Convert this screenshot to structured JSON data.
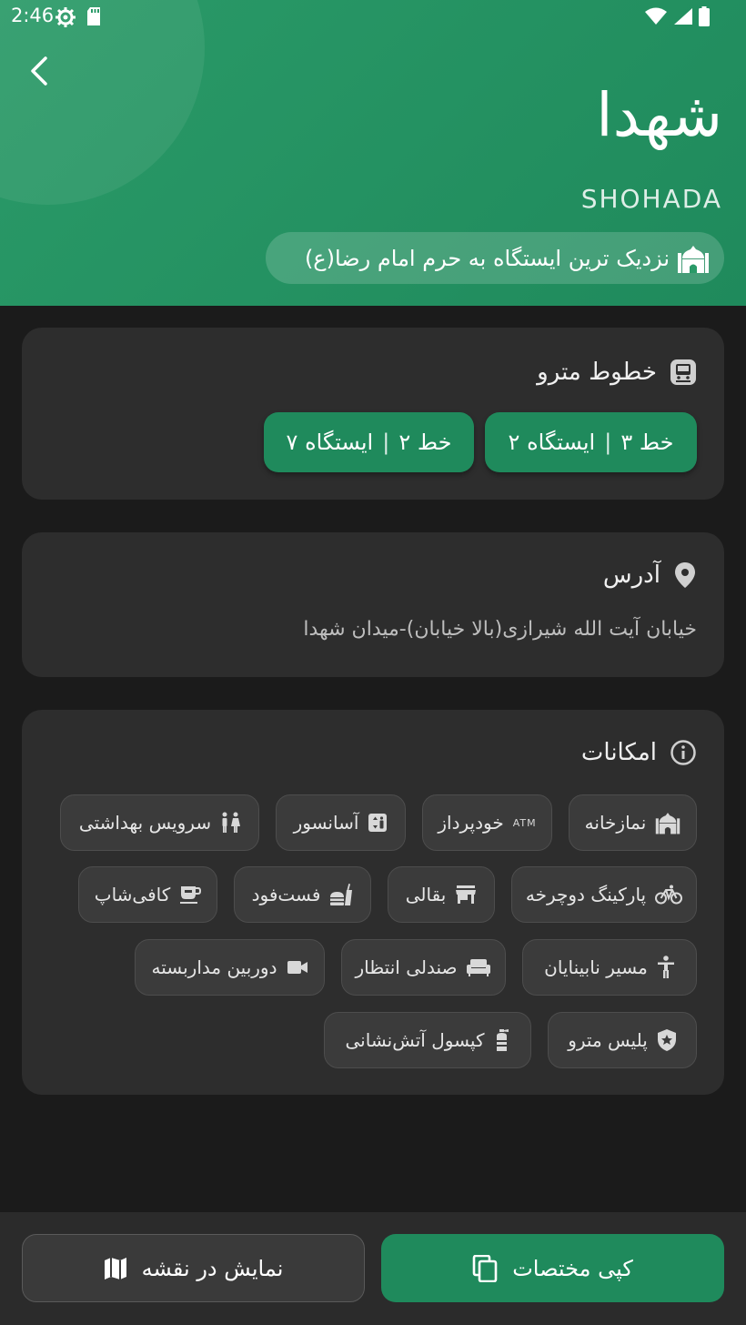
{
  "status_bar": {
    "time": "2:46"
  },
  "header": {
    "title": "شهدا",
    "latin_title": "SHOHADA",
    "nearest_note": "نزدیک ترین ایستگاه به حرم امام رضا(ع)"
  },
  "metro_lines": {
    "title": "خطوط مترو",
    "chips": [
      {
        "line": "خط ۳",
        "station": "ایستگاه ۲"
      },
      {
        "line": "خط ۲",
        "station": "ایستگاه ۷"
      }
    ]
  },
  "address": {
    "title": "آدرس",
    "text": "خیابان آیت الله شیرازی(بالا خیابان)-میدان شهدا"
  },
  "facilities": {
    "title": "امکانات",
    "items": [
      {
        "label": "نمازخانه",
        "icon": "mosque-icon"
      },
      {
        "label": "خودپرداز",
        "icon": "atm-icon",
        "icon_text": "ATM"
      },
      {
        "label": "آسانسور",
        "icon": "elevator-icon"
      },
      {
        "label": "سرویس بهداشتی",
        "icon": "restroom-icon"
      },
      {
        "label": "پارکینگ دوچرخه",
        "icon": "bicycle-icon"
      },
      {
        "label": "بقالی",
        "icon": "store-icon"
      },
      {
        "label": "فست‌فود",
        "icon": "fastfood-icon"
      },
      {
        "label": "کافی‌شاپ",
        "icon": "coffee-icon"
      },
      {
        "label": "مسیر نابینایان",
        "icon": "accessibility-icon"
      },
      {
        "label": "صندلی انتظار",
        "icon": "sofa-icon"
      },
      {
        "label": "دوربین مداربسته",
        "icon": "camera-icon"
      },
      {
        "label": "پلیس مترو",
        "icon": "police-shield-icon"
      },
      {
        "label": "کپسول آتش‌نشانی",
        "icon": "fire-extinguisher-icon"
      }
    ]
  },
  "actions": {
    "copy_label": "کپی مختصات",
    "map_label": "نمایش در نقشه"
  },
  "colors": {
    "accent": "#1f8a5c",
    "header": "#2a9a68",
    "background": "#1b1b1b",
    "card": "#2d2d2d"
  }
}
